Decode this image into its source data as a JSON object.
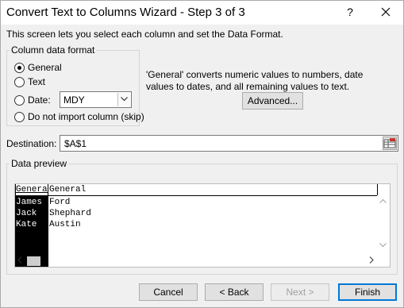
{
  "window": {
    "title": "Convert Text to Columns Wizard - Step 3 of 3",
    "help": "?",
    "close": "✕"
  },
  "description": "This screen lets you select each column and set the Data Format.",
  "column_format": {
    "legend": "Column data format",
    "options": [
      {
        "label": "General",
        "checked": true
      },
      {
        "label": "Text",
        "checked": false
      },
      {
        "label": "Date:",
        "checked": false
      },
      {
        "label": "Do not import column (skip)",
        "checked": false
      }
    ],
    "date_format": "MDY"
  },
  "info_text": "'General' converts numeric values to numbers, date values to dates, and all remaining values to text.",
  "advanced_button": "Advanced...",
  "destination": {
    "label": "Destination:",
    "value": "$A$1"
  },
  "preview": {
    "legend": "Data preview",
    "headers": [
      "General",
      "General"
    ],
    "rows": [
      [
        "James",
        "Ford"
      ],
      [
        "Jack",
        "Shephard"
      ],
      [
        "Kate",
        "Austin"
      ]
    ]
  },
  "buttons": {
    "cancel": "Cancel",
    "back": "< Back",
    "next": "Next >",
    "finish": "Finish"
  },
  "colors": {
    "selected_column_bg": "#000000",
    "selected_column_fg": "#ffffff",
    "default_button_border": "#0078d7"
  }
}
